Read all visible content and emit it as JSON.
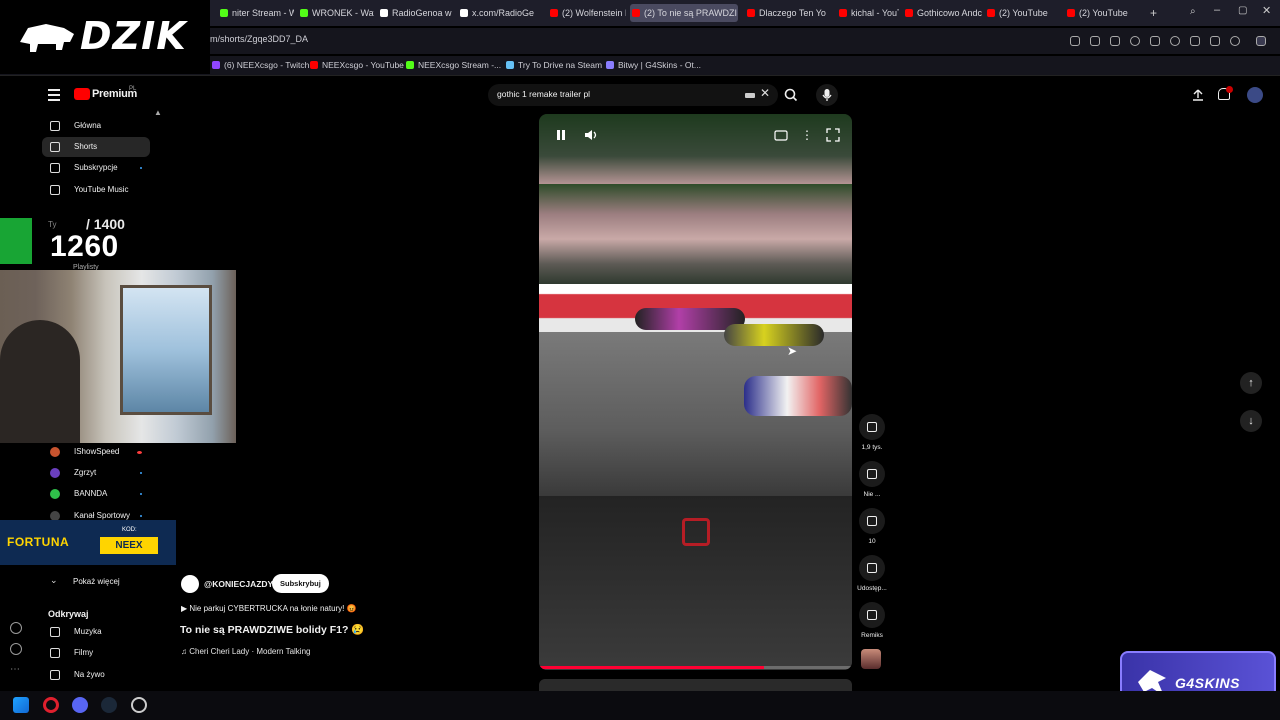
{
  "browser": {
    "tabs": [
      {
        "label": "niter Stream - W",
        "color": "#53fc18"
      },
      {
        "label": "WRONEK - Watc",
        "color": "#53fc18"
      },
      {
        "label": "RadioGenoa w si",
        "color": "#ffffff"
      },
      {
        "label": "x.com/RadioGen",
        "color": "#ffffff"
      },
      {
        "label": "(2) Wolfenstein I",
        "color": "#ff0000"
      },
      {
        "label": "(2) To nie są PRAWDZI",
        "color": "#ff0000",
        "active": true
      },
      {
        "label": "Dlaczego Ten Yo",
        "color": "#ff0000"
      },
      {
        "label": "kichal - YouTube",
        "color": "#ff0000"
      },
      {
        "label": "Gothicowo Andc",
        "color": "#ff0000"
      },
      {
        "label": "(2) YouTube",
        "color": "#ff0000"
      },
      {
        "label": "(2) YouTube",
        "color": "#ff0000"
      }
    ],
    "url": "m/shorts/Zgqe3DD7_DA",
    "bookmarks": [
      {
        "label": "(6) NEEXcsgo - Twitch",
        "color": "#9146ff"
      },
      {
        "label": "NEEXcsgo - YouTube",
        "color": "#ff0000"
      },
      {
        "label": "NEEXcsgo Stream -...",
        "color": "#53fc18"
      },
      {
        "label": "Try To Drive na Steam",
        "color": "#66c0f4"
      },
      {
        "label": "Bitwy | G4Skins - Ot...",
        "color": "#8a7dff"
      }
    ]
  },
  "overlay": {
    "brand": "DZIK",
    "goal_small": "Ty",
    "goal_target": "/ 1400",
    "goal_current": "1260",
    "sponsor": "FORTUNA",
    "sponsor_kod": "KOD:",
    "sponsor_code": "NEEX",
    "partner": "G4SKINS"
  },
  "youtube": {
    "logo": "Premium",
    "logo_sup": "PL",
    "search_query": "gothic 1 remake trailer pl",
    "sidebar_top": [
      {
        "label": "Główna",
        "icon": "home-icon"
      },
      {
        "label": "Shorts",
        "icon": "shorts-icon",
        "active": true
      },
      {
        "label": "Subskrypcje",
        "icon": "subscriptions-icon",
        "dot": true
      },
      {
        "label": "YouTube Music",
        "icon": "music-icon"
      }
    ],
    "sidebar_playlist": "Playlisty",
    "sidebar_subs": [
      {
        "label": "IShowSpeed",
        "color": "#c8542f",
        "live": true
      },
      {
        "label": "Zgrzyt",
        "color": "#6a3fbf",
        "dot": true
      },
      {
        "label": "BANNDA",
        "color": "#2fbf4a",
        "dot": true
      },
      {
        "label": "Kanał Sportowy",
        "color": "#444",
        "dot": true
      }
    ],
    "show_more": "Pokaż więcej",
    "explore_header": "Odkrywaj",
    "explore": [
      {
        "label": "Muzyka",
        "icon": "music-note-icon"
      },
      {
        "label": "Filmy",
        "icon": "film-icon"
      },
      {
        "label": "Na żywo",
        "icon": "live-icon"
      }
    ],
    "short": {
      "channel": "@KONIECJAZDY",
      "subscribe": "Subskrybuj",
      "description": "▶ Nie parkuj CYBERTRUCKA na łonie natury! 😡",
      "title": "To nie są PRAWDZIWE bolidy F1? 😢",
      "song": "♫ Cheri Cheri Lady · Modern Talking",
      "progress": 0.72
    },
    "actions": [
      {
        "icon": "like-icon",
        "label": "1,9 tys."
      },
      {
        "icon": "dislike-icon",
        "label": "Nie ..."
      },
      {
        "icon": "comments-icon",
        "label": "10"
      },
      {
        "icon": "share-icon",
        "label": "Udostęp..."
      },
      {
        "icon": "remix-icon",
        "label": "Remiks"
      }
    ]
  }
}
